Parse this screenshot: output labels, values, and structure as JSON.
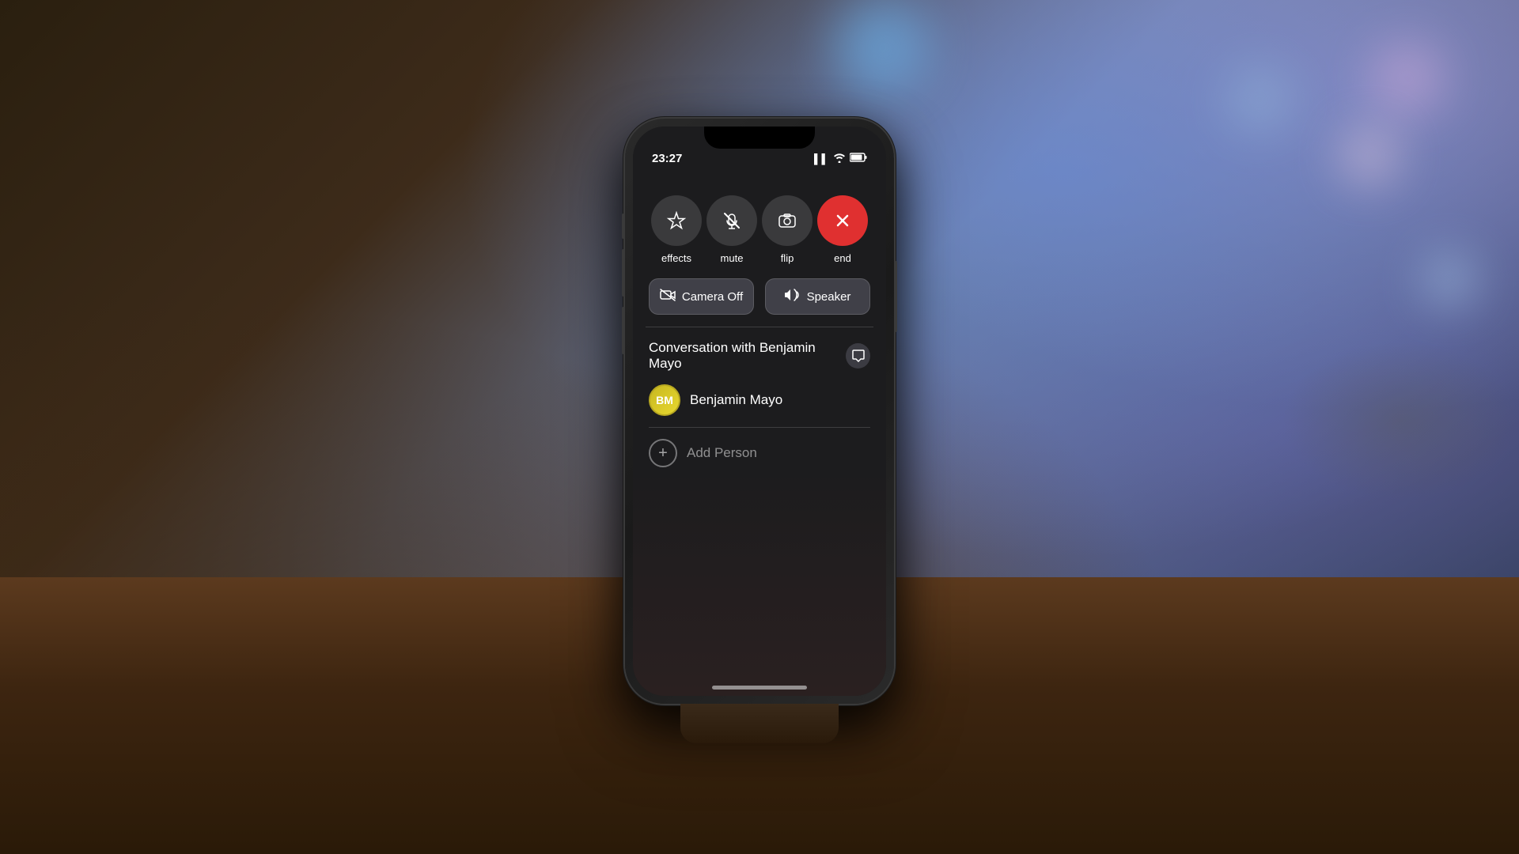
{
  "background": {
    "description": "Bokeh background with desk"
  },
  "status_bar": {
    "time": "23:27",
    "signal": "▌▌",
    "wifi": "wifi",
    "battery": "battery"
  },
  "call_controls": {
    "buttons": [
      {
        "id": "effects",
        "label": "effects",
        "icon": "✦"
      },
      {
        "id": "mute",
        "label": "mute",
        "icon": "🎤"
      },
      {
        "id": "flip",
        "label": "flip",
        "icon": "📷"
      },
      {
        "id": "end",
        "label": "end",
        "icon": "✕",
        "variant": "end"
      }
    ],
    "toggles": [
      {
        "id": "camera-off",
        "label": "Camera Off",
        "icon": "📹"
      },
      {
        "id": "speaker",
        "label": "Speaker",
        "icon": "🔊"
      }
    ]
  },
  "conversation": {
    "title": "Conversation with Benjamin Mayo",
    "message_icon": "💬",
    "contact": {
      "initials": "BM",
      "name": "Benjamin Mayo"
    },
    "add_person_label": "Add Person"
  },
  "home_indicator": {}
}
